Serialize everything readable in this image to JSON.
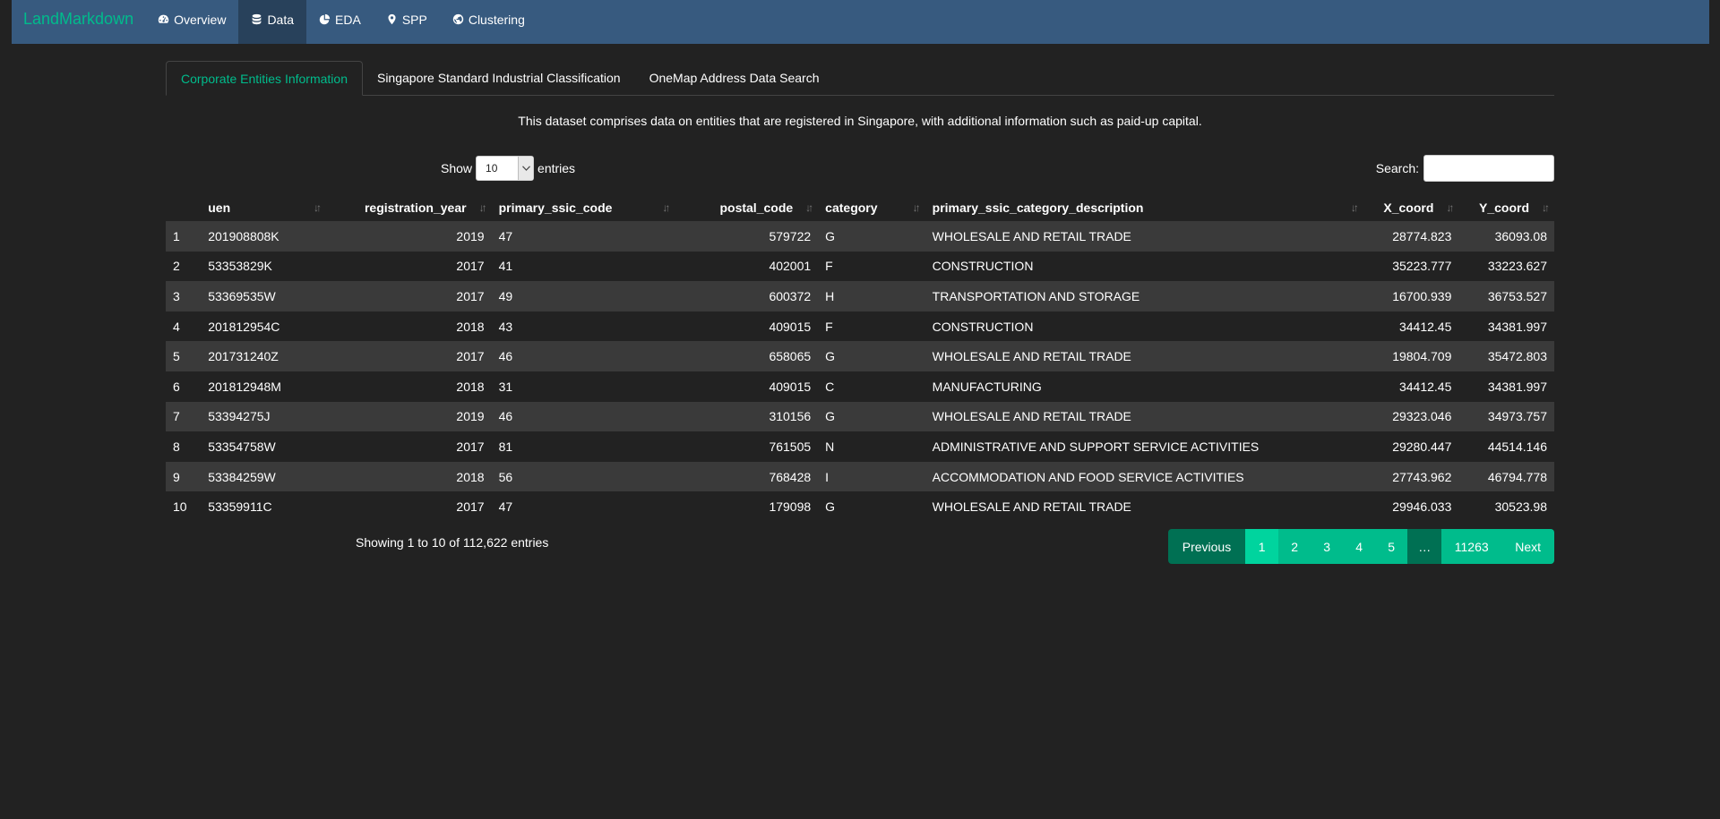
{
  "navbar": {
    "brand": "LandMarkdown",
    "items": [
      {
        "label": "Overview",
        "icon": "tachometer-icon"
      },
      {
        "label": "Data",
        "icon": "database-icon"
      },
      {
        "label": "EDA",
        "icon": "pie-chart-icon"
      },
      {
        "label": "SPP",
        "icon": "map-marker-icon"
      },
      {
        "label": "Clustering",
        "icon": "globe-icon"
      }
    ],
    "active": "Data"
  },
  "tabs": [
    {
      "label": "Corporate Entities Information"
    },
    {
      "label": "Singapore Standard Industrial Classification"
    },
    {
      "label": "OneMap Address Data Search"
    }
  ],
  "description": "This dataset comprises data on entities that are registered in Singapore, with additional information such as paid-up capital.",
  "controls": {
    "show_label": "Show",
    "entries_value": "10",
    "entries_label": "entries",
    "search_label": "Search:",
    "search_value": ""
  },
  "table": {
    "columns": [
      "",
      "uen",
      "registration_year",
      "primary_ssic_code",
      "postal_code",
      "category",
      "primary_ssic_category_description",
      "X_coord",
      "Y_coord"
    ],
    "rows": [
      [
        "1",
        "201908808K",
        "2019",
        "47",
        "579722",
        "G",
        "WHOLESALE AND RETAIL TRADE",
        "28774.823",
        "36093.08"
      ],
      [
        "2",
        "53353829K",
        "2017",
        "41",
        "402001",
        "F",
        "CONSTRUCTION",
        "35223.777",
        "33223.627"
      ],
      [
        "3",
        "53369535W",
        "2017",
        "49",
        "600372",
        "H",
        "TRANSPORTATION AND STORAGE",
        "16700.939",
        "36753.527"
      ],
      [
        "4",
        "201812954C",
        "2018",
        "43",
        "409015",
        "F",
        "CONSTRUCTION",
        "34412.45",
        "34381.997"
      ],
      [
        "5",
        "201731240Z",
        "2017",
        "46",
        "658065",
        "G",
        "WHOLESALE AND RETAIL TRADE",
        "19804.709",
        "35472.803"
      ],
      [
        "6",
        "201812948M",
        "2018",
        "31",
        "409015",
        "C",
        "MANUFACTURING",
        "34412.45",
        "34381.997"
      ],
      [
        "7",
        "53394275J",
        "2019",
        "46",
        "310156",
        "G",
        "WHOLESALE AND RETAIL TRADE",
        "29323.046",
        "34973.757"
      ],
      [
        "8",
        "53354758W",
        "2017",
        "81",
        "761505",
        "N",
        "ADMINISTRATIVE AND SUPPORT SERVICE ACTIVITIES",
        "29280.447",
        "44514.146"
      ],
      [
        "9",
        "53384259W",
        "2018",
        "56",
        "768428",
        "I",
        "ACCOMMODATION AND FOOD SERVICE ACTIVITIES",
        "27743.962",
        "46794.778"
      ],
      [
        "10",
        "53359911C",
        "2017",
        "47",
        "179098",
        "G",
        "WHOLESALE AND RETAIL TRADE",
        "29946.033",
        "30523.98"
      ]
    ]
  },
  "footer": {
    "info": "Showing 1 to 10 of 112,622 entries",
    "pagination": [
      "Previous",
      "1",
      "2",
      "3",
      "4",
      "5",
      "…",
      "11263",
      "Next"
    ]
  }
}
